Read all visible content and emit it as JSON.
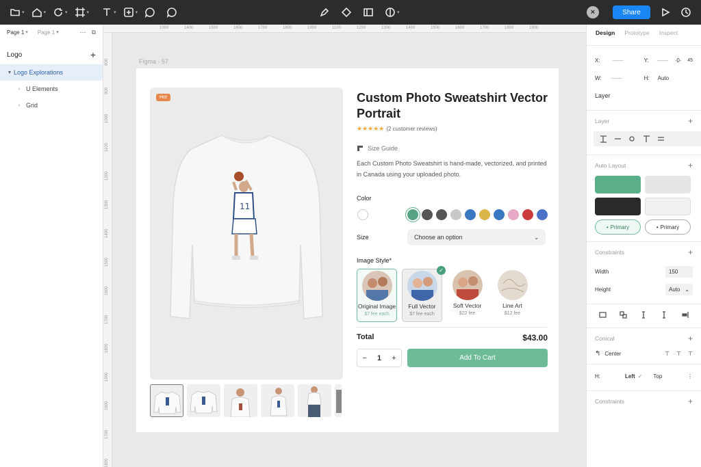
{
  "toolbar": {
    "share_label": "Share",
    "close_label": "×"
  },
  "left_panel": {
    "page_current": "Page 1",
    "page_other": "Page 1",
    "layers_title": "Logo",
    "layers": [
      {
        "label": "Logo Explorations",
        "selected": true
      },
      {
        "label": "U Elements",
        "selected": false
      },
      {
        "label": "Grid",
        "selected": false
      }
    ]
  },
  "canvas": {
    "frame_label": "Figma · 57",
    "ruler_top": [
      "1000",
      "1400",
      "1500",
      "1600",
      "1700",
      "1800",
      "1900",
      "1100",
      "1200",
      "1300",
      "1400",
      "1500",
      "1600",
      "1700",
      "1800",
      "1900"
    ],
    "ruler_left": [
      "800",
      "900",
      "1000",
      "1100",
      "1200",
      "1300",
      "1400",
      "1500",
      "1600",
      "1700",
      "1800",
      "1900",
      "1600",
      "1700",
      "1800"
    ]
  },
  "product": {
    "badge": "Hot",
    "title": "Custom Photo Sweatshirt Vector Portrait",
    "stars": "★★★★★",
    "reviews": "(2 customer reviews)",
    "size_guide": "Size Guide",
    "description": "Each Custom Photo Sweatshirt is hand-made, vectorized, and printed in Canada using your uploaded photo.",
    "color_label": "Color",
    "colors": [
      "#ffffff",
      "#55a383",
      "#555555",
      "#555555",
      "#c8c8c8",
      "#3a78c2",
      "#d9b54a",
      "#3a78c2",
      "#e6a8c4",
      "#cc3b3b",
      "#4a72c8"
    ],
    "size_label": "Size",
    "size_placeholder": "Choose an option",
    "image_style_label": "Image Style*",
    "styles": [
      {
        "name": "Original Image",
        "price": "$7 fee each"
      },
      {
        "name": "Full Vector",
        "price": "$7 fee each"
      },
      {
        "name": "Soft Vector",
        "price": "$22 fee"
      },
      {
        "name": "Line Art",
        "price": "$12 fee"
      }
    ],
    "total_label": "Total",
    "total_value": "$43.00",
    "qty_minus": "−",
    "qty_value": "1",
    "qty_plus": "+",
    "add_to_cart": "Add To Cart",
    "jersey_number": "11"
  },
  "right_panel": {
    "tabs": [
      "Design",
      "Prototype",
      "Inspect"
    ],
    "x_label": "X:",
    "y_label": "Y:",
    "y_value": "·0·",
    "y_extra": "45",
    "w_label": "W:",
    "h_label": "H:",
    "h_value": "Auto",
    "layer_label": "Layer",
    "layer_section": "Layer",
    "auto_layout": "Auto Layout",
    "btn_colors": [
      "#5aaf8a",
      "#e6e6e6",
      "#2a2a2a",
      "#f0f0f0"
    ],
    "pill_labels": [
      "Primary",
      "Primary"
    ],
    "constraints": "Constraints",
    "width_label": "Width",
    "width_value": "150",
    "height_label": "Height",
    "height_value": "Auto",
    "conical": "Conical",
    "center_label": "Center",
    "h_row_label": "H:",
    "left_value": "Left",
    "top_value": "Top",
    "constraints2": "Constraints"
  }
}
